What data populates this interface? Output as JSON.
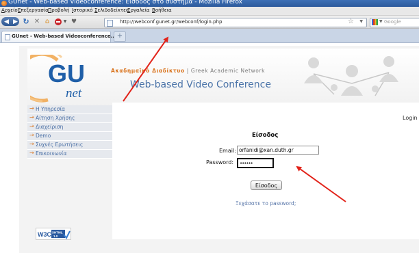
{
  "window": {
    "title": "GUnet - Web-based Videoconference: Είσοδος στο σύστημα - Mozilla Firefox"
  },
  "menubar": {
    "items": [
      "Αρχείο",
      "Επεξεργασία",
      "Προβολή",
      "Ιστορικό",
      "Σελιδοδείκτες",
      "Εργαλεία",
      "Βοήθεια"
    ]
  },
  "navbar": {
    "url": "http://webconf.gunet.gr/webconf/login.php",
    "search_placeholder": "Google"
  },
  "tabs": [
    {
      "label": "GUnet - Web-based Videoconference..."
    }
  ],
  "header": {
    "logo_main": "GU",
    "logo_sub": "net",
    "tagline_greek": "Ακαδημαϊκό Διαδίκτυο",
    "tagline_sep": "|",
    "tagline_english": "Greek Academic Network",
    "title": "Web-based Video Conference"
  },
  "sidebar": {
    "items": [
      {
        "label": "Η Υπηρεσία"
      },
      {
        "label": "Αίτηση Χρήσης"
      },
      {
        "label": "Διαχείριση"
      },
      {
        "label": "Demo"
      },
      {
        "label": "Συχνές Ερωτήσεις"
      },
      {
        "label": "Επικοινωνία"
      }
    ]
  },
  "main": {
    "login_link": "Login",
    "form_title": "Είσοδος",
    "email_label": "Email:",
    "email_value": "orfanidi@xan.duth.gr",
    "password_label": "Password:",
    "password_value": "••••••",
    "submit_label": "Είσοδος",
    "forgot_link": "Ξεχάσατε το password;"
  },
  "badge": {
    "w3c": "W3C",
    "xhtml": "XHTML",
    "version": "1.0"
  },
  "colors": {
    "accent_orange": "#d9731d",
    "link_blue": "#4a6fa5",
    "annotation_red": "#e2231a"
  }
}
